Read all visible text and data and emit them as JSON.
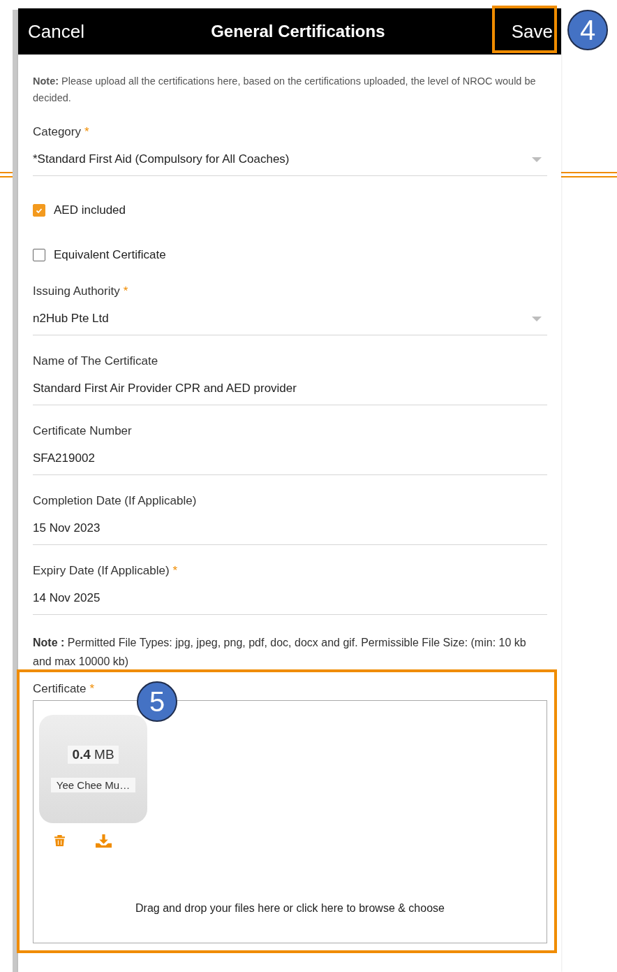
{
  "header": {
    "cancel": "Cancel",
    "title": "General Certifications",
    "save": "Save"
  },
  "note": "**Note:** Please upload all the certifications here, based on the certifications uploaded, the level of NROC would be decided.",
  "fields": [
    {
      "kind": "select",
      "label": "Category",
      "required_mark": "*",
      "value": "*Standard First Aid (Compulsory for All Coaches)"
    },
    {
      "kind": "checkbox",
      "label": "AED included",
      "checked": true
    },
    {
      "kind": "checkbox",
      "label": "Equivalent Certificate",
      "checked": false
    },
    {
      "kind": "select",
      "label": "Issuing Authority",
      "required_mark": "*",
      "value": "n2Hub Pte Ltd"
    },
    {
      "kind": "text",
      "label": "Name of The Certificate",
      "value": "Standard First Air Provider CPR and AED provider"
    },
    {
      "kind": "text",
      "label": "Certificate Number",
      "value": "SFA219002"
    },
    {
      "kind": "text",
      "label": "Completion Date (If Applicable)",
      "value": "15 Nov 2023"
    },
    {
      "kind": "text",
      "label": "Expiry Date (If Applicable)",
      "required_mark": "*",
      "value": "14 Nov 2025"
    }
  ],
  "file_note": "**Note :** Permitted File Types: jpg, jpeg, png, pdf, doc, docx and gif. Permissible File Size: (min: 10 kb and max 10000 kb)",
  "upload": {
    "label": "Certificate",
    "required_mark": "*",
    "files": [
      {
        "size": "**0.4** MB",
        "name": "Yee Chee Mu…"
      }
    ],
    "hint": "Drag and drop your files here or click here to browse & choose"
  },
  "callouts": [
    {
      "number": "4"
    },
    {
      "number": "5"
    }
  ]
}
